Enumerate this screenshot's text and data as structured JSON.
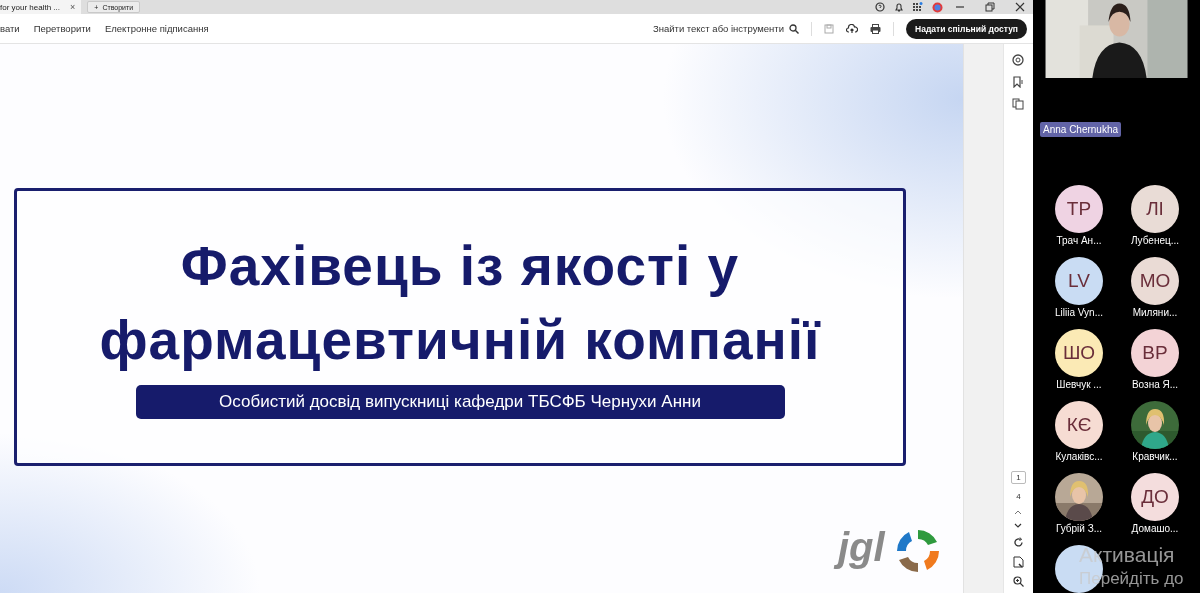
{
  "tab_bar": {
    "tabs": [
      {
        "label": "for your health ...",
        "close": "×",
        "selected": true
      }
    ],
    "new_tab": {
      "icon": "+",
      "label": "Створити"
    }
  },
  "toolbar": {
    "menu": [
      "вати",
      "Перетворити",
      "Електронне підписання"
    ],
    "search": "Знайти текст або інструменти",
    "share_button": "Надати спільний доступ"
  },
  "slide": {
    "title_lines": [
      "Фахівець із якості у",
      "фармацевтичній компанії"
    ],
    "subtitle": "Особистий досвід випускниці кафедри ТБСФБ Чернухи Анни",
    "logo": "jgl"
  },
  "page_nav": {
    "current": "1",
    "total": "4"
  },
  "video": {
    "presenter": "Anna Chernukha",
    "participant_rows": [
      {
        "tiles": [
          {
            "kind": "avatar",
            "initials": "ТР",
            "name": "Трач Ан...",
            "color": "#efd3e3"
          },
          {
            "kind": "avatar",
            "initials": "ЛІ",
            "name": "Лубенец...",
            "color": "#e9dcd6"
          }
        ]
      },
      {
        "tiles": [
          {
            "kind": "avatar",
            "initials": "LV",
            "name": "Liliia Vyn...",
            "color": "#c9dcf3"
          },
          {
            "kind": "avatar",
            "initials": "МО",
            "name": "Миляни...",
            "color": "#eadbd5"
          }
        ]
      },
      {
        "tiles": [
          {
            "kind": "avatar",
            "initials": "ШО",
            "name": "Шевчук ...",
            "color": "#fbeab5"
          },
          {
            "kind": "avatar",
            "initials": "ВР",
            "name": "Возна Я...",
            "color": "#f3d3d6"
          }
        ]
      },
      {
        "tiles": [
          {
            "kind": "avatar",
            "initials": "КЄ",
            "name": "Кулаківс...",
            "color": "#f6dcd3"
          },
          {
            "name": "Кравчик..."
          }
        ]
      },
      {
        "tiles": [
          {
            "name": "Губрій З..."
          },
          {
            "kind": "avatar",
            "initials": "ДО",
            "name": "Домашо...",
            "color": "#f4dddd"
          }
        ]
      },
      {
        "tiles": [
          {
            "kind": "avatar",
            "color": "#c9dcf3"
          }
        ]
      }
    ]
  },
  "os_notice": [
    "Активація",
    "Перейдіть до"
  ]
}
